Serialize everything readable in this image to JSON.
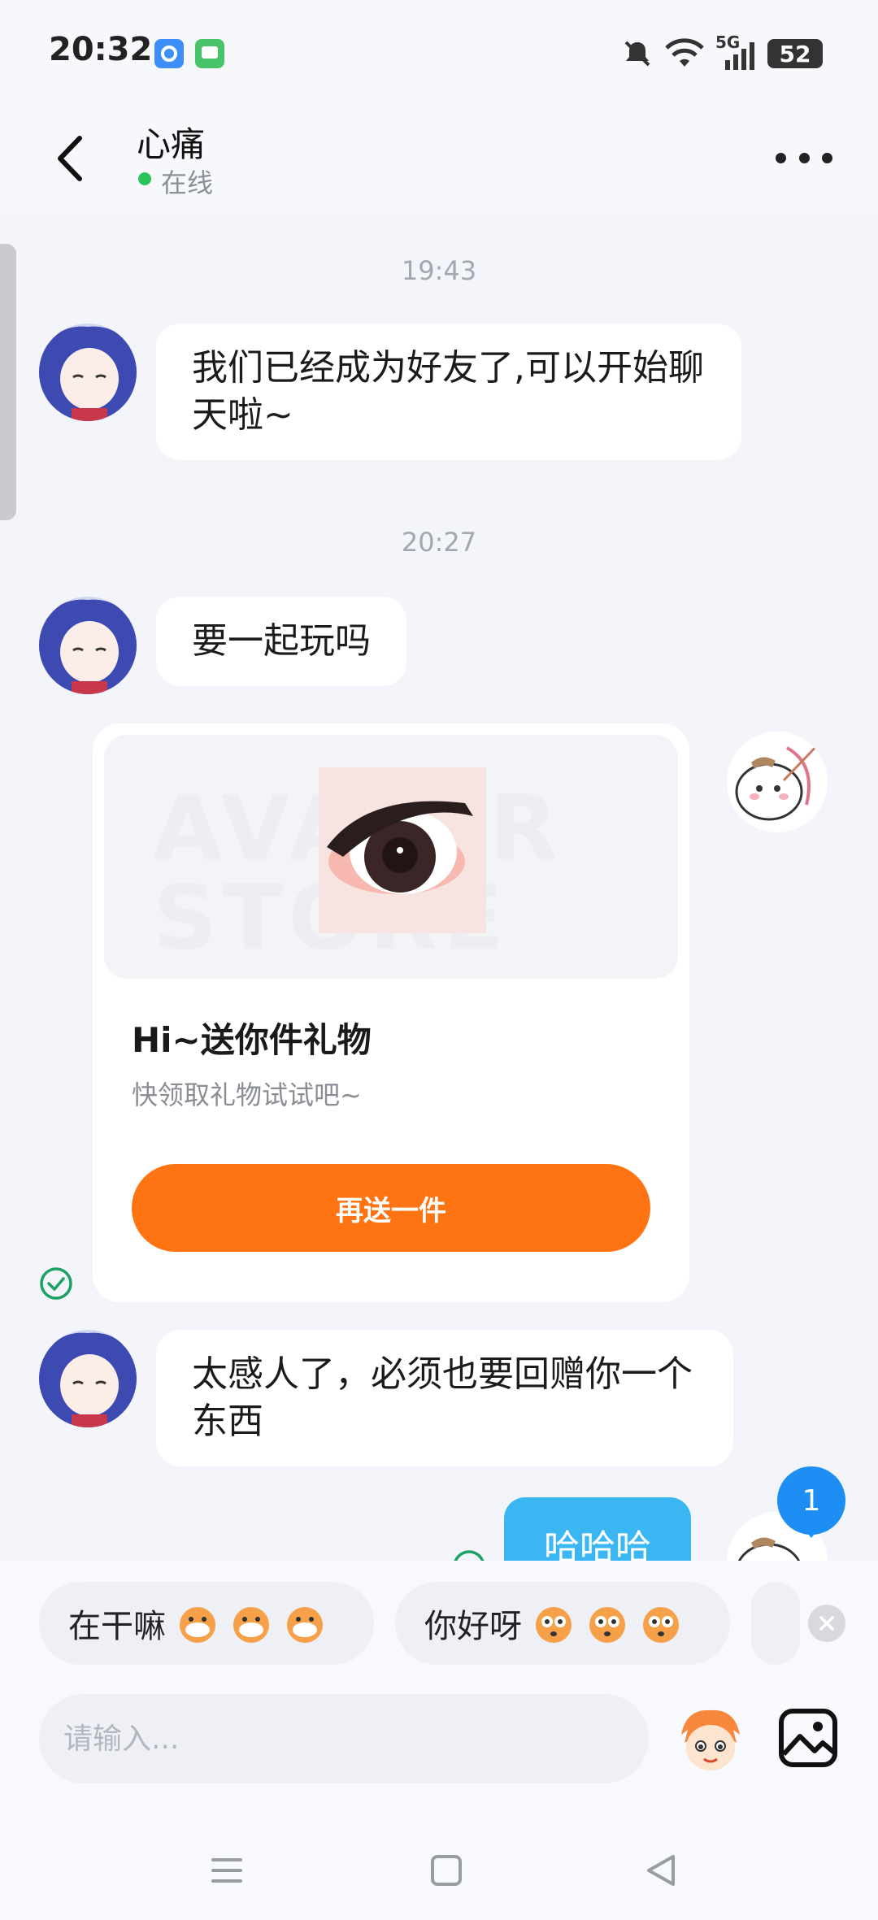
{
  "status_bar": {
    "time": "20:32",
    "battery": "52",
    "network": "5G"
  },
  "header": {
    "title": "心痛",
    "status": "在线"
  },
  "messages": {
    "time1": "19:43",
    "msg1": "我们已经成为好友了,可以开始聊天啦~",
    "time2": "20:27",
    "msg2": "要一起玩吗",
    "gift": {
      "banner_watermark": "AVATAR STORE",
      "title": "Hi~送你件礼物",
      "subtitle": "快领取礼物试试吧~",
      "button": "再送一件"
    },
    "msg3": "太感人了，必须也要回赠你一个东西",
    "my_msg": "哈哈哈",
    "unread_badge": "1"
  },
  "quick_replies": [
    {
      "text": "在干嘛"
    },
    {
      "text": "你好呀"
    }
  ],
  "input": {
    "placeholder": "请输入..."
  },
  "colors": {
    "accent_orange": "#ff7412",
    "my_bubble": "#3ab7f2",
    "badge": "#1d8ef4",
    "online": "#2bc45a"
  },
  "icons": [
    "back-icon",
    "more-icon",
    "read-check-icon",
    "emoji-icon",
    "image-icon",
    "close-icon",
    "menu-icon",
    "home-icon",
    "back-nav-icon"
  ]
}
